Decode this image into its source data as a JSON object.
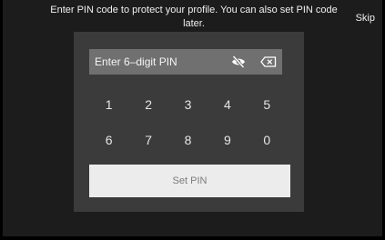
{
  "prompt": {
    "text": "Enter PIN code to protect your profile. You can also set PIN code later."
  },
  "skip_label": "Skip",
  "pin_field": {
    "placeholder": "Enter 6–digit PIN",
    "icons": [
      "eye-slash-icon",
      "backspace-icon"
    ]
  },
  "keypad": {
    "row1": [
      "1",
      "2",
      "3",
      "4",
      "5"
    ],
    "row2": [
      "6",
      "7",
      "8",
      "9",
      "0"
    ]
  },
  "set_pin_label": "Set PIN",
  "colors": {
    "background": "#1c1c1c",
    "panel": "#3b3b3b",
    "field": "#707070",
    "button": "#ececec",
    "button_text": "#7c7c7c"
  }
}
